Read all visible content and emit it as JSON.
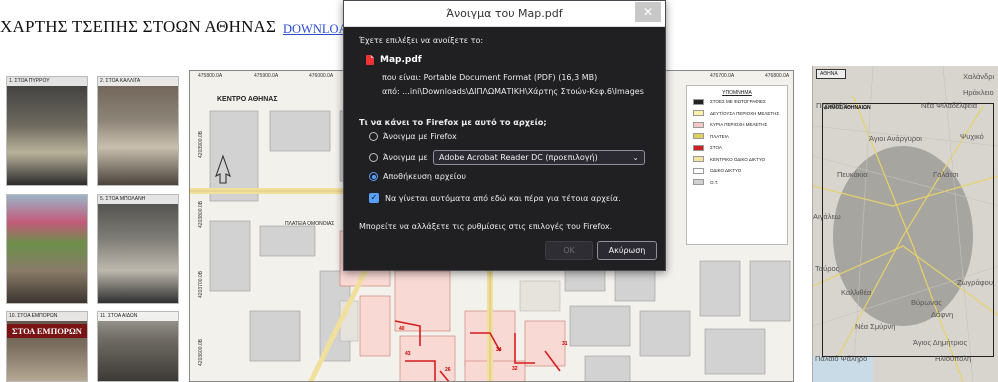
{
  "page": {
    "title": "ΧΑΡΤΗΣ ΤΣΕΠΗΣ ΣΤΟΩΝ ΑΘΗΝΑΣ",
    "download_link": "DOWNLOA",
    "photos": [
      {
        "caption": "1. ΣΤΟΑ ΠΥΡΡΟΥ"
      },
      {
        "caption": "2. ΣΤΟΑ ΚΑΛΛΙΓΑ"
      },
      {
        "caption": ""
      },
      {
        "caption": "5. ΣΤΟΑ ΜΠΟΛΑΝΗ"
      },
      {
        "caption": "10. ΣΤΟΑ ΕΜΠΟΡΩΝ",
        "sign": "ΣΤΟΑ ΕΜΠΟΡΩΝ"
      },
      {
        "caption": "11. ΣΤΟΑ ΑΙΔΩΝ"
      }
    ]
  },
  "map": {
    "coords_top": [
      "475800.0A",
      "475900.0A",
      "476000.0A",
      "476700.0A",
      "476800.0A"
    ],
    "coords_left": [
      "4203900.0B",
      "4203800.0B",
      "4203700.0B",
      "4203600.0B"
    ],
    "title": "ΚΕΝΤΡΟ ΑΘΗΝΑΣ",
    "street_label": "ΠΛΑΤΕΙΑ ΟΜΟΝΟΙΑΣ",
    "legend": {
      "title": "ΥΠΟΜΝΗΜΑ",
      "items": [
        {
          "label": "ΣΤΟΕΣ ΜΕ ΦΩΤΟΓΡΑΦΙΕΣ",
          "color": "#222222"
        },
        {
          "label": "ΔΕΥΤ/ΟΥΣΑ ΠΕΡΙΟΧΗ ΜΕΛΕΤΗΣ",
          "color": "#fff2a8"
        },
        {
          "label": "ΚΥΡΙΑ ΠΕΡΙΟΧΗ ΜΕΛΕΤΗΣ",
          "color": "#f7c8c8"
        },
        {
          "label": "ΠΛΑΤΕΙΑ",
          "color": "#e0d060"
        },
        {
          "label": "ΣΤΟΑ",
          "color": "#cc2020"
        },
        {
          "label": "ΚΕΝΤΡΙΚΟ ΟΔΙΚΟ ΔΙΚΤΥΟ",
          "color": "#f4e3a0"
        },
        {
          "label": "ΟΔΙΚΟ ΔΙΚΤΥΟ",
          "color": "#ffffff"
        },
        {
          "label": "Ο.Τ.",
          "color": "#d0d0d0"
        }
      ]
    },
    "block_numbers": [
      "40",
      "34",
      "32",
      "31",
      "26",
      "43"
    ]
  },
  "overview": {
    "tag": "ΑΘΗΝΑ",
    "box_label": "ΔΗΜΟΣ ΑΘΗΝΑΙΩΝ",
    "places": [
      "Περιστέρι",
      "Νέα Φιλαδέλφεια",
      "Ηράκλειο",
      "Πευκάκια",
      "Αιγάλεω",
      "Ζωγράφου",
      "Καλλιθέα",
      "Βύρωνας",
      "Νέα Σμύρνη",
      "Παλαιό Φάληρο",
      "Ψυχικό",
      "Γαλάτσι",
      "Ταύρος",
      "Άγιος Δημήτριος",
      "Δάφνη",
      "Ηλιούπολη",
      "Χαλάνδρι",
      "Άγιοι Ανάργυροι"
    ]
  },
  "dialog": {
    "title": "Άνοιγμα του Map.pdf",
    "close_glyph": "✕",
    "intro": "Έχετε επιλέξει να ανοίξετε το:",
    "filename": "Map.pdf",
    "type_line": "που είναι: Portable Document Format (PDF) (16,3 MB)",
    "from_line": "από: ...ini\\Downloads\\ΔΙΠΛΩΜΑΤΙΚΗ\\Χάρτης Στοών-Κεφ.6\\Images",
    "question": "Τι να κάνει το Firefox με αυτό το αρχείο;",
    "option_open_firefox": "Άνοιγμα με Firefox",
    "option_open_with": "Άνοιγμα με",
    "app_select": "Adobe Acrobat Reader DC (προεπιλογή)",
    "option_save": "Αποθήκευση αρχείου",
    "selected_option": "save",
    "auto_checkbox": "Να γίνεται αυτόματα από εδώ και πέρα για τέτοια αρχεία.",
    "auto_checked": true,
    "footer_note": "Μπορείτε να αλλάξετε τις ρυθμίσεις στις επιλογές του Firefox.",
    "ok_label": "OK",
    "cancel_label": "Ακύρωση"
  }
}
